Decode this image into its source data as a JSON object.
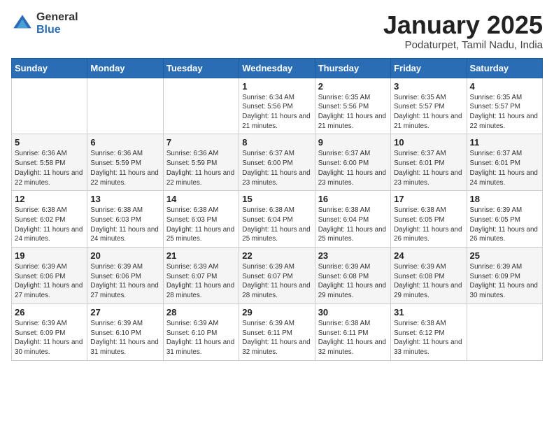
{
  "header": {
    "logo_general": "General",
    "logo_blue": "Blue",
    "month_title": "January 2025",
    "location": "Podaturpet, Tamil Nadu, India"
  },
  "weekdays": [
    "Sunday",
    "Monday",
    "Tuesday",
    "Wednesday",
    "Thursday",
    "Friday",
    "Saturday"
  ],
  "weeks": [
    [
      {
        "day": "",
        "info": ""
      },
      {
        "day": "",
        "info": ""
      },
      {
        "day": "",
        "info": ""
      },
      {
        "day": "1",
        "info": "Sunrise: 6:34 AM\nSunset: 5:56 PM\nDaylight: 11 hours and 21 minutes."
      },
      {
        "day": "2",
        "info": "Sunrise: 6:35 AM\nSunset: 5:56 PM\nDaylight: 11 hours and 21 minutes."
      },
      {
        "day": "3",
        "info": "Sunrise: 6:35 AM\nSunset: 5:57 PM\nDaylight: 11 hours and 21 minutes."
      },
      {
        "day": "4",
        "info": "Sunrise: 6:35 AM\nSunset: 5:57 PM\nDaylight: 11 hours and 22 minutes."
      }
    ],
    [
      {
        "day": "5",
        "info": "Sunrise: 6:36 AM\nSunset: 5:58 PM\nDaylight: 11 hours and 22 minutes."
      },
      {
        "day": "6",
        "info": "Sunrise: 6:36 AM\nSunset: 5:59 PM\nDaylight: 11 hours and 22 minutes."
      },
      {
        "day": "7",
        "info": "Sunrise: 6:36 AM\nSunset: 5:59 PM\nDaylight: 11 hours and 22 minutes."
      },
      {
        "day": "8",
        "info": "Sunrise: 6:37 AM\nSunset: 6:00 PM\nDaylight: 11 hours and 23 minutes."
      },
      {
        "day": "9",
        "info": "Sunrise: 6:37 AM\nSunset: 6:00 PM\nDaylight: 11 hours and 23 minutes."
      },
      {
        "day": "10",
        "info": "Sunrise: 6:37 AM\nSunset: 6:01 PM\nDaylight: 11 hours and 23 minutes."
      },
      {
        "day": "11",
        "info": "Sunrise: 6:37 AM\nSunset: 6:01 PM\nDaylight: 11 hours and 24 minutes."
      }
    ],
    [
      {
        "day": "12",
        "info": "Sunrise: 6:38 AM\nSunset: 6:02 PM\nDaylight: 11 hours and 24 minutes."
      },
      {
        "day": "13",
        "info": "Sunrise: 6:38 AM\nSunset: 6:03 PM\nDaylight: 11 hours and 24 minutes."
      },
      {
        "day": "14",
        "info": "Sunrise: 6:38 AM\nSunset: 6:03 PM\nDaylight: 11 hours and 25 minutes."
      },
      {
        "day": "15",
        "info": "Sunrise: 6:38 AM\nSunset: 6:04 PM\nDaylight: 11 hours and 25 minutes."
      },
      {
        "day": "16",
        "info": "Sunrise: 6:38 AM\nSunset: 6:04 PM\nDaylight: 11 hours and 25 minutes."
      },
      {
        "day": "17",
        "info": "Sunrise: 6:38 AM\nSunset: 6:05 PM\nDaylight: 11 hours and 26 minutes."
      },
      {
        "day": "18",
        "info": "Sunrise: 6:39 AM\nSunset: 6:05 PM\nDaylight: 11 hours and 26 minutes."
      }
    ],
    [
      {
        "day": "19",
        "info": "Sunrise: 6:39 AM\nSunset: 6:06 PM\nDaylight: 11 hours and 27 minutes."
      },
      {
        "day": "20",
        "info": "Sunrise: 6:39 AM\nSunset: 6:06 PM\nDaylight: 11 hours and 27 minutes."
      },
      {
        "day": "21",
        "info": "Sunrise: 6:39 AM\nSunset: 6:07 PM\nDaylight: 11 hours and 28 minutes."
      },
      {
        "day": "22",
        "info": "Sunrise: 6:39 AM\nSunset: 6:07 PM\nDaylight: 11 hours and 28 minutes."
      },
      {
        "day": "23",
        "info": "Sunrise: 6:39 AM\nSunset: 6:08 PM\nDaylight: 11 hours and 29 minutes."
      },
      {
        "day": "24",
        "info": "Sunrise: 6:39 AM\nSunset: 6:08 PM\nDaylight: 11 hours and 29 minutes."
      },
      {
        "day": "25",
        "info": "Sunrise: 6:39 AM\nSunset: 6:09 PM\nDaylight: 11 hours and 30 minutes."
      }
    ],
    [
      {
        "day": "26",
        "info": "Sunrise: 6:39 AM\nSunset: 6:09 PM\nDaylight: 11 hours and 30 minutes."
      },
      {
        "day": "27",
        "info": "Sunrise: 6:39 AM\nSunset: 6:10 PM\nDaylight: 11 hours and 31 minutes."
      },
      {
        "day": "28",
        "info": "Sunrise: 6:39 AM\nSunset: 6:10 PM\nDaylight: 11 hours and 31 minutes."
      },
      {
        "day": "29",
        "info": "Sunrise: 6:39 AM\nSunset: 6:11 PM\nDaylight: 11 hours and 32 minutes."
      },
      {
        "day": "30",
        "info": "Sunrise: 6:38 AM\nSunset: 6:11 PM\nDaylight: 11 hours and 32 minutes."
      },
      {
        "day": "31",
        "info": "Sunrise: 6:38 AM\nSunset: 6:12 PM\nDaylight: 11 hours and 33 minutes."
      },
      {
        "day": "",
        "info": ""
      }
    ]
  ]
}
